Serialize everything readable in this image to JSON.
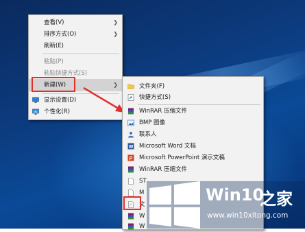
{
  "context_menu": {
    "items": [
      {
        "label": "查看(V)",
        "submenu": true,
        "disabled": false
      },
      {
        "label": "排序方式(O)",
        "submenu": true,
        "disabled": false
      },
      {
        "label": "刷新(E)",
        "submenu": false,
        "disabled": false
      },
      {
        "label": "粘贴(P)",
        "submenu": false,
        "disabled": true
      },
      {
        "label": "粘贴快捷方式(S)",
        "submenu": false,
        "disabled": true
      },
      {
        "label": "新建(W)",
        "submenu": true,
        "disabled": false,
        "highlighted": true
      },
      {
        "label": "显示设置(D)",
        "submenu": false,
        "disabled": false,
        "icon": "monitor-icon"
      },
      {
        "label": "个性化(R)",
        "submenu": false,
        "disabled": false,
        "icon": "personalize-icon"
      }
    ]
  },
  "new_submenu": {
    "items": [
      {
        "label": "文件夹(F)",
        "icon": "folder-icon"
      },
      {
        "label": "快捷方式(S)",
        "icon": "shortcut-icon"
      },
      {
        "label": "WinRAR 压缩文件",
        "icon": "winrar-icon"
      },
      {
        "label": "BMP 图像",
        "icon": "bmp-icon"
      },
      {
        "label": "联系人",
        "icon": "contact-icon"
      },
      {
        "label": "Microsoft Word 文档",
        "icon": "word-icon"
      },
      {
        "label": "Microsoft PowerPoint 演示文稿",
        "icon": "powerpoint-icon"
      },
      {
        "label": "WinRAR 压缩文件",
        "icon": "winrar-icon"
      },
      {
        "label": "ST",
        "icon": "document-icon"
      },
      {
        "label": "M",
        "icon": "document-icon"
      },
      {
        "label": "文",
        "icon": "text-document-icon"
      },
      {
        "label": "W",
        "icon": "winrar-icon"
      },
      {
        "label": "W",
        "icon": "winrar-icon"
      }
    ]
  },
  "watermark": {
    "brand_win": "Win10",
    "brand_cn": "之家",
    "url": "www.win10xitong.com"
  },
  "colors": {
    "annotation_red": "#e0302a",
    "menu_bg": "#f2f2f2",
    "desktop_blue": "#0c3c80"
  }
}
